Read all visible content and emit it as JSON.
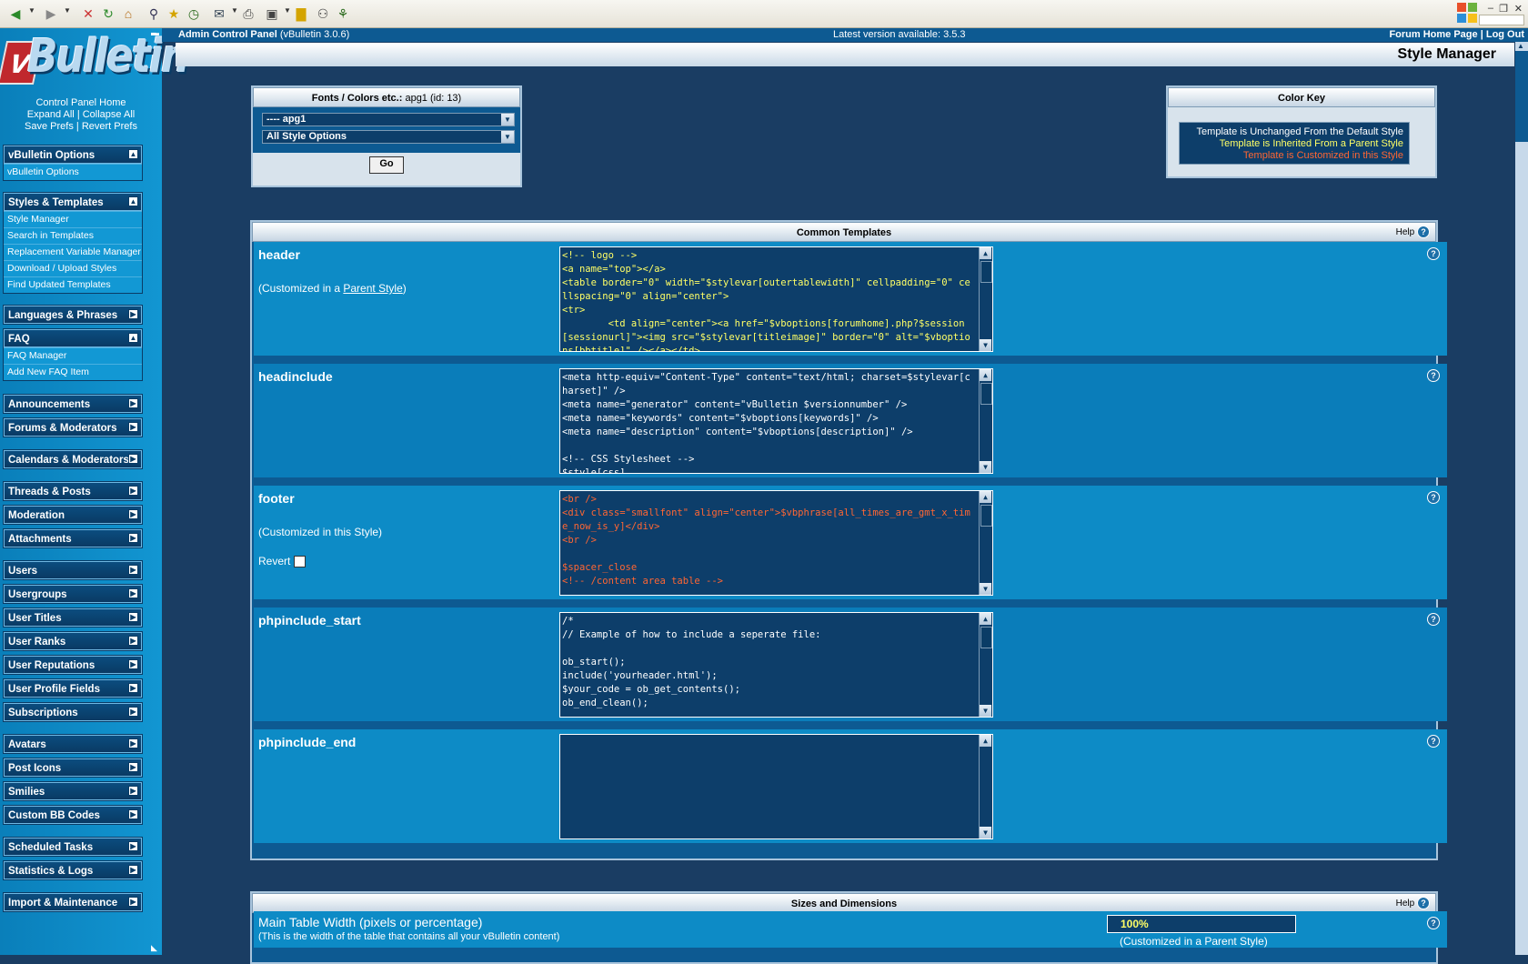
{
  "toolbar": {
    "icons": [
      "back-icon",
      "forward-icon",
      "stop-icon",
      "refresh-icon",
      "home-icon",
      "search-icon",
      "favorites-icon",
      "history-icon",
      "mail-icon",
      "print-icon",
      "edit-icon",
      "folder-icon",
      "messenger-icon",
      "research-icon"
    ]
  },
  "sidebar": {
    "links": {
      "home": "Control Panel Home",
      "expand": "Expand All",
      "collapse": "Collapse All",
      "save": "Save Prefs",
      "revert": "Revert Prefs",
      "sep": "|"
    },
    "groups": [
      {
        "title": "vBulletin Options",
        "expanded": true,
        "items": [
          "vBulletin Options"
        ]
      },
      {
        "title": "Styles & Templates",
        "expanded": true,
        "items": [
          "Style Manager",
          "Search in Templates",
          "Replacement Variable Manager",
          "Download / Upload Styles",
          "Find Updated Templates"
        ]
      },
      {
        "title": "Languages & Phrases",
        "expanded": false,
        "items": []
      },
      {
        "title": "FAQ",
        "expanded": true,
        "items": [
          "FAQ Manager",
          "Add New FAQ Item"
        ]
      },
      {
        "title": "Announcements",
        "expanded": false,
        "items": []
      },
      {
        "title": "Forums & Moderators",
        "expanded": false,
        "items": []
      },
      {
        "title": "Calendars & Moderators",
        "expanded": false,
        "items": []
      },
      {
        "title": "Threads & Posts",
        "expanded": false,
        "items": []
      },
      {
        "title": "Moderation",
        "expanded": false,
        "items": []
      },
      {
        "title": "Attachments",
        "expanded": false,
        "items": []
      },
      {
        "title": "Users",
        "expanded": false,
        "items": []
      },
      {
        "title": "Usergroups",
        "expanded": false,
        "items": []
      },
      {
        "title": "User Titles",
        "expanded": false,
        "items": []
      },
      {
        "title": "User Ranks",
        "expanded": false,
        "items": []
      },
      {
        "title": "User Reputations",
        "expanded": false,
        "items": []
      },
      {
        "title": "User Profile Fields",
        "expanded": false,
        "items": []
      },
      {
        "title": "Subscriptions",
        "expanded": false,
        "items": []
      },
      {
        "title": "Avatars",
        "expanded": false,
        "items": []
      },
      {
        "title": "Post Icons",
        "expanded": false,
        "items": []
      },
      {
        "title": "Smilies",
        "expanded": false,
        "items": []
      },
      {
        "title": "Custom BB Codes",
        "expanded": false,
        "items": []
      },
      {
        "title": "Scheduled Tasks",
        "expanded": false,
        "items": []
      },
      {
        "title": "Statistics & Logs",
        "expanded": false,
        "items": []
      },
      {
        "title": "Import & Maintenance",
        "expanded": false,
        "items": []
      }
    ]
  },
  "header": {
    "app_title": "Admin Control Panel",
    "app_version": "(vBulletin 3.0.6)",
    "latest_version": "Latest version available: 3.5.3",
    "forum_home": "Forum Home Page",
    "sep": "|",
    "log_out": "Log Out",
    "page_title": "Style Manager"
  },
  "style_selector": {
    "title_bold": "Fonts / Colors etc.:",
    "title_rest": "apg1 (id: 13)",
    "style_value": "---- apg1",
    "option_value": "All Style Options",
    "go_label": "Go"
  },
  "color_key": {
    "title": "Color Key",
    "unchanged": "Template is Unchanged From the Default Style",
    "inherited": "Template is Inherited From a Parent Style",
    "customized": "Template is Customized in this Style",
    "colors": {
      "unchanged": "#ffffff",
      "inherited": "#ffff66",
      "customized": "#ff6633"
    }
  },
  "common_templates": {
    "title": "Common Templates",
    "help": "Help",
    "rows": [
      {
        "name": "header",
        "note_prefix": "(Customized in a ",
        "note_link": "Parent Style",
        "note_suffix": ")",
        "state": "inherited",
        "code": "<!-- logo -->\n<a name=\"top\"></a>\n<table border=\"0\" width=\"$stylevar[outertablewidth]\" cellpadding=\"0\" cellspacing=\"0\" align=\"center\">\n<tr>\n\t<td align=\"center\"><a href=\"$vboptions[forumhome].php?$session[sessionurl]\"><img src=\"$stylevar[titleimage]\" border=\"0\" alt=\"$vboptions[bbtitle]\" /></a></td>"
      },
      {
        "name": "headinclude",
        "state": "unchanged",
        "code": "<meta http-equiv=\"Content-Type\" content=\"text/html; charset=$stylevar[charset]\" />\n<meta name=\"generator\" content=\"vBulletin $versionnumber\" />\n<meta name=\"keywords\" content=\"$vboptions[keywords]\" />\n<meta name=\"description\" content=\"$vboptions[description]\" />\n\n<!-- CSS Stylesheet -->\n$style[css]"
      },
      {
        "name": "footer",
        "note": "(Customized in this Style)",
        "revert_label": "Revert",
        "state": "customized",
        "code": "<br />\n<div class=\"smallfont\" align=\"center\">$vbphrase[all_times_are_gmt_x_time_now_is_y]</div>\n<br />\n\n$spacer_close\n<!-- /content area table -->"
      },
      {
        "name": "phpinclude_start",
        "state": "unchanged",
        "code": "/*\n// Example of how to include a seperate file:\n\nob_start();\ninclude('yourheader.html');\n$your_code = ob_get_contents();\nob_end_clean();"
      },
      {
        "name": "phpinclude_end",
        "state": "unchanged",
        "code": ""
      }
    ]
  },
  "sizes": {
    "title": "Sizes and Dimensions",
    "help": "Help",
    "main_width_label": "Main Table Width (pixels or percentage)",
    "main_width_sub": "(This is the width of the table that contains all your vBulletin content)",
    "main_width_value": "100%",
    "main_width_note": "(Customized in a Parent Style)"
  }
}
